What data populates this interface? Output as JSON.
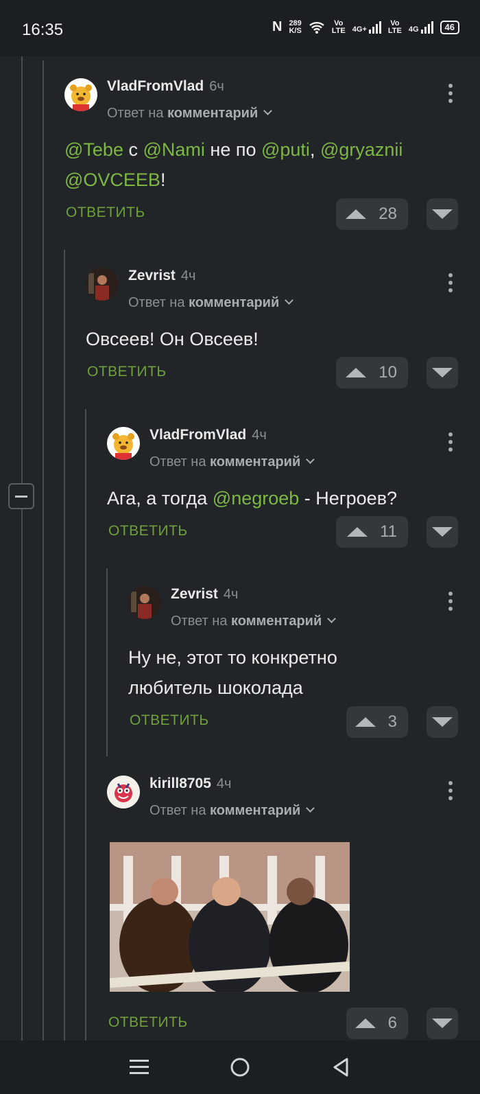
{
  "status": {
    "time": "16:35",
    "speed_top": "289",
    "speed_bottom": "K/S",
    "sim1": "Vo\nLTE",
    "net1": "4G+",
    "sim2": "Vo\nLTE",
    "net2": "4G",
    "battery": "46"
  },
  "labels": {
    "reply_prefix": "Ответ на",
    "reply_target": "комментарий",
    "reply_button": "ОТВЕТИТЬ"
  },
  "comments": [
    {
      "author": "VladFromVlad",
      "time": "6ч",
      "votes": "28",
      "text_parts": [
        "@Tebe",
        " с ",
        "@Nami",
        " не по ",
        "@puti",
        ", ",
        "@gryaznii",
        "@OVCEEB",
        "!"
      ]
    },
    {
      "author": "Zevrist",
      "time": "4ч",
      "votes": "10",
      "text": "Овсеев! Он Овсеев!"
    },
    {
      "author": "VladFromVlad",
      "time": "4ч",
      "votes": "11",
      "text_parts": [
        "Ага, а тогда ",
        "@negroeb",
        " - Негроев?"
      ]
    },
    {
      "author": "Zevrist",
      "time": "4ч",
      "votes": "3",
      "text_line1": "Ну не, этот то конкретно",
      "text_line2": "любитель шоколада"
    },
    {
      "author": "kirill8705",
      "time": "4ч",
      "votes": "6"
    }
  ],
  "icons": {
    "menu": "menu-icon",
    "home": "home-icon",
    "back": "back-icon"
  },
  "colors": {
    "background": "#222528",
    "mention": "#7db744",
    "reply": "#6fa13a"
  }
}
